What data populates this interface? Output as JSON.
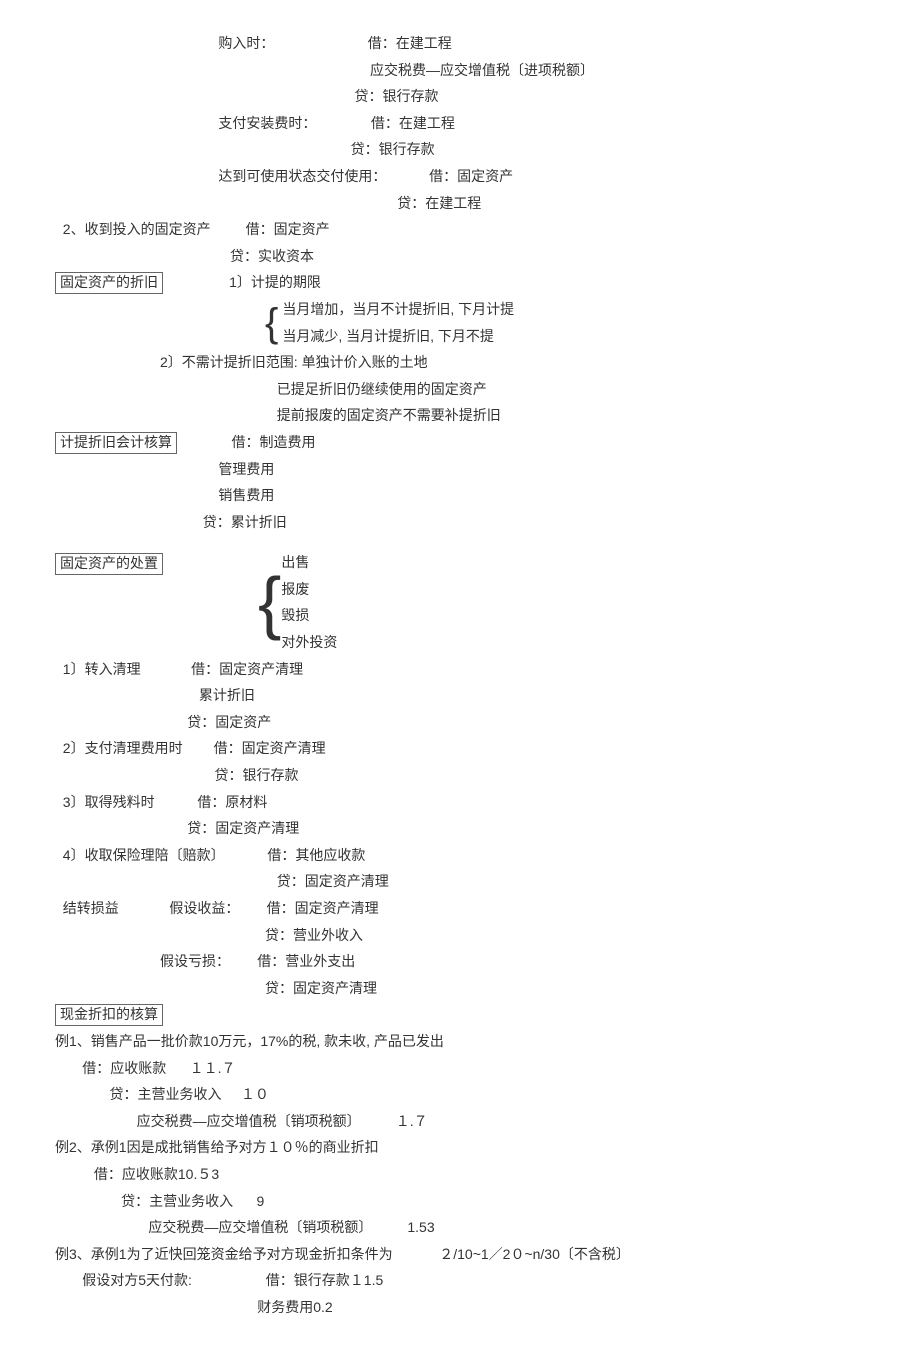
{
  "l1": "                                          购入时：                        借：在建工程",
  "l2": "                                                                                 应交税费—应交增值税〔进项税额〕",
  "l3": "                                                                             贷：银行存款",
  "l4": "                                          支付安装费时：              借：在建工程",
  "l5": "                                                                            贷：银行存款",
  "l6": "                                          达到可使用状态交付使用：           借：固定资产",
  "l7": "                                                                                        贷：在建工程",
  "l8a": "  2、收到投入的固定资产         借：固定资产",
  "l8b": "                                             贷：实收资本",
  "box1": "固定资产的折旧",
  "l9": "                 1〕计提的期限",
  "brace1a": "当月增加，当月不计提折旧, 下月计提",
  "brace1b": "当月减少, 当月计提折旧, 下月不提",
  "l10": "                           2〕不需计提折旧范围: 单独计价入账的土地",
  "l11": "                                                         已提足折旧仍继续使用的固定资产",
  "l12": "                                                         提前报废的固定资产不需要补提折旧",
  "box2": "计提折旧会计核算",
  "l13": "              借：制造费用",
  "l14": "                                          管理费用",
  "l15": "                                          销售费用",
  "l16": "                                      贷：累计折旧",
  "box3": "固定资产的处置",
  "brace2a": "出售",
  "brace2b": "报废",
  "brace2c": "毁损",
  "brace2d": "对外投资",
  "l17": "  1〕转入清理             借：固定资产清理",
  "l18": "                                     累计折旧",
  "l19": "                                  贷：固定资产",
  "l20": "  2〕支付清理费用时        借：固定资产清理",
  "l21": "                                         贷：银行存款",
  "l22": "  3〕取得残料时           借：原材料",
  "l23": "                                  贷：固定资产清理",
  "l24": "  4〕收取保险理陪〔赔款〕           借：其他应收款",
  "l25": "                                                         贷：固定资产清理",
  "l26": "  结转损益             假设收益：       借：固定资产清理",
  "l27": "                                                      贷：营业外收入",
  "l28": "                           假设亏损：       借：营业外支出",
  "l29": "                                                      贷：固定资产清理",
  "box4": "现金折扣的核算",
  "l30": "例1、销售产品一批价款10万元，17%的税, 款未收, 产品已发出",
  "l31": "       借：应收账款      １１.７",
  "l32": "              贷：主营业务收入     １０",
  "l33": "                     应交税费—应交增值税〔销项税额〕         １.７",
  "l34": "例2、承例1因是成批销售给予对方１０％的商业折扣",
  "l35": "          借：应收账款10.５3",
  "l36": "                 贷：主营业务收入      9",
  "l37": "                        应交税费—应交增值税〔销项税额〕         1.53",
  "l38": "例3、承例1为了近快回笼资金给予对方现金折扣条件为            ２/10~1／2０~n/30〔不含税〕",
  "l39": "       假设对方5天付款:                   借：银行存款１1.5",
  "l40": "                                                    财务费用0.2"
}
